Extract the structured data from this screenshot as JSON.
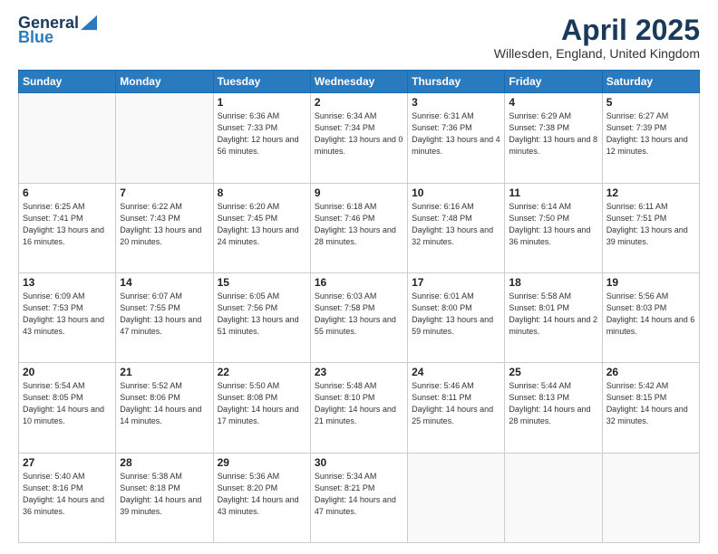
{
  "header": {
    "logo_general": "General",
    "logo_blue": "Blue",
    "title": "April 2025",
    "location": "Willesden, England, United Kingdom"
  },
  "days_of_week": [
    "Sunday",
    "Monday",
    "Tuesday",
    "Wednesday",
    "Thursday",
    "Friday",
    "Saturday"
  ],
  "weeks": [
    [
      {
        "day": "",
        "info": ""
      },
      {
        "day": "",
        "info": ""
      },
      {
        "day": "1",
        "info": "Sunrise: 6:36 AM\nSunset: 7:33 PM\nDaylight: 12 hours\nand 56 minutes."
      },
      {
        "day": "2",
        "info": "Sunrise: 6:34 AM\nSunset: 7:34 PM\nDaylight: 13 hours\nand 0 minutes."
      },
      {
        "day": "3",
        "info": "Sunrise: 6:31 AM\nSunset: 7:36 PM\nDaylight: 13 hours\nand 4 minutes."
      },
      {
        "day": "4",
        "info": "Sunrise: 6:29 AM\nSunset: 7:38 PM\nDaylight: 13 hours\nand 8 minutes."
      },
      {
        "day": "5",
        "info": "Sunrise: 6:27 AM\nSunset: 7:39 PM\nDaylight: 13 hours\nand 12 minutes."
      }
    ],
    [
      {
        "day": "6",
        "info": "Sunrise: 6:25 AM\nSunset: 7:41 PM\nDaylight: 13 hours\nand 16 minutes."
      },
      {
        "day": "7",
        "info": "Sunrise: 6:22 AM\nSunset: 7:43 PM\nDaylight: 13 hours\nand 20 minutes."
      },
      {
        "day": "8",
        "info": "Sunrise: 6:20 AM\nSunset: 7:45 PM\nDaylight: 13 hours\nand 24 minutes."
      },
      {
        "day": "9",
        "info": "Sunrise: 6:18 AM\nSunset: 7:46 PM\nDaylight: 13 hours\nand 28 minutes."
      },
      {
        "day": "10",
        "info": "Sunrise: 6:16 AM\nSunset: 7:48 PM\nDaylight: 13 hours\nand 32 minutes."
      },
      {
        "day": "11",
        "info": "Sunrise: 6:14 AM\nSunset: 7:50 PM\nDaylight: 13 hours\nand 36 minutes."
      },
      {
        "day": "12",
        "info": "Sunrise: 6:11 AM\nSunset: 7:51 PM\nDaylight: 13 hours\nand 39 minutes."
      }
    ],
    [
      {
        "day": "13",
        "info": "Sunrise: 6:09 AM\nSunset: 7:53 PM\nDaylight: 13 hours\nand 43 minutes."
      },
      {
        "day": "14",
        "info": "Sunrise: 6:07 AM\nSunset: 7:55 PM\nDaylight: 13 hours\nand 47 minutes."
      },
      {
        "day": "15",
        "info": "Sunrise: 6:05 AM\nSunset: 7:56 PM\nDaylight: 13 hours\nand 51 minutes."
      },
      {
        "day": "16",
        "info": "Sunrise: 6:03 AM\nSunset: 7:58 PM\nDaylight: 13 hours\nand 55 minutes."
      },
      {
        "day": "17",
        "info": "Sunrise: 6:01 AM\nSunset: 8:00 PM\nDaylight: 13 hours\nand 59 minutes."
      },
      {
        "day": "18",
        "info": "Sunrise: 5:58 AM\nSunset: 8:01 PM\nDaylight: 14 hours\nand 2 minutes."
      },
      {
        "day": "19",
        "info": "Sunrise: 5:56 AM\nSunset: 8:03 PM\nDaylight: 14 hours\nand 6 minutes."
      }
    ],
    [
      {
        "day": "20",
        "info": "Sunrise: 5:54 AM\nSunset: 8:05 PM\nDaylight: 14 hours\nand 10 minutes."
      },
      {
        "day": "21",
        "info": "Sunrise: 5:52 AM\nSunset: 8:06 PM\nDaylight: 14 hours\nand 14 minutes."
      },
      {
        "day": "22",
        "info": "Sunrise: 5:50 AM\nSunset: 8:08 PM\nDaylight: 14 hours\nand 17 minutes."
      },
      {
        "day": "23",
        "info": "Sunrise: 5:48 AM\nSunset: 8:10 PM\nDaylight: 14 hours\nand 21 minutes."
      },
      {
        "day": "24",
        "info": "Sunrise: 5:46 AM\nSunset: 8:11 PM\nDaylight: 14 hours\nand 25 minutes."
      },
      {
        "day": "25",
        "info": "Sunrise: 5:44 AM\nSunset: 8:13 PM\nDaylight: 14 hours\nand 28 minutes."
      },
      {
        "day": "26",
        "info": "Sunrise: 5:42 AM\nSunset: 8:15 PM\nDaylight: 14 hours\nand 32 minutes."
      }
    ],
    [
      {
        "day": "27",
        "info": "Sunrise: 5:40 AM\nSunset: 8:16 PM\nDaylight: 14 hours\nand 36 minutes."
      },
      {
        "day": "28",
        "info": "Sunrise: 5:38 AM\nSunset: 8:18 PM\nDaylight: 14 hours\nand 39 minutes."
      },
      {
        "day": "29",
        "info": "Sunrise: 5:36 AM\nSunset: 8:20 PM\nDaylight: 14 hours\nand 43 minutes."
      },
      {
        "day": "30",
        "info": "Sunrise: 5:34 AM\nSunset: 8:21 PM\nDaylight: 14 hours\nand 47 minutes."
      },
      {
        "day": "",
        "info": ""
      },
      {
        "day": "",
        "info": ""
      },
      {
        "day": "",
        "info": ""
      }
    ]
  ]
}
